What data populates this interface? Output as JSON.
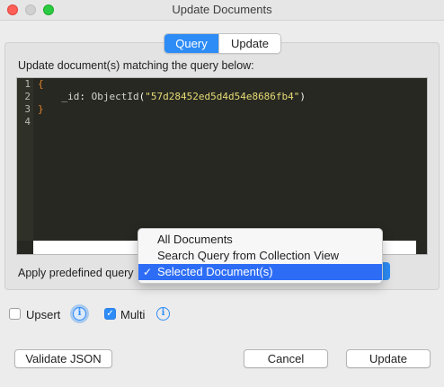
{
  "window": {
    "title": "Update Documents"
  },
  "tabs": {
    "query": "Query",
    "update": "Update",
    "active": "Query"
  },
  "editor": {
    "label": "Update document(s) matching the query below:",
    "line_numbers": [
      "1",
      "2",
      "3",
      "4"
    ],
    "lines": [
      {
        "brace": "{"
      },
      {
        "key": "_id",
        "colon": ": ",
        "fn": "ObjectId",
        "open": "(",
        "str": "\"57d28452ed5d4d54e8686fb4\"",
        "close": ")"
      },
      {
        "brace": "}"
      }
    ]
  },
  "predefined": {
    "label": "Apply predefined query",
    "options": [
      "All Documents",
      "Search Query from Collection View",
      "Selected Document(s)"
    ],
    "selected": "Selected Document(s)",
    "check": "✓"
  },
  "options": {
    "upsert_label": "Upsert",
    "upsert_checked": false,
    "multi_label": "Multi",
    "multi_checked": true,
    "info_glyph": "i"
  },
  "buttons": {
    "validate": "Validate JSON",
    "cancel": "Cancel",
    "update": "Update"
  },
  "colors": {
    "accent": "#2d8cf6",
    "editor_bg": "#272822",
    "string": "#e6db74",
    "brace": "#e0822a"
  }
}
